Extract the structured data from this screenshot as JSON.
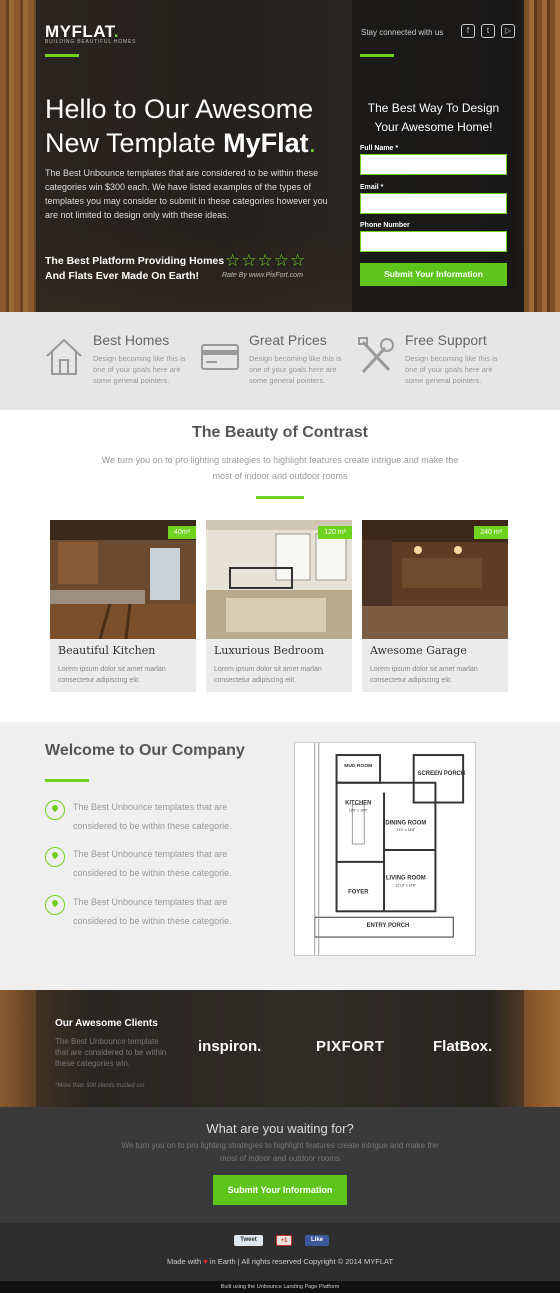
{
  "hero": {
    "logo": "MYFLAT",
    "logo_dot": ".",
    "logo_sub": "BUILDING BEAUTIFUL HOMES",
    "title_line1": "Hello to Our Awesome",
    "title_line2_pre": "New Template ",
    "title_line2_bold": "MyFlat",
    "title_dot": ".",
    "paragraph": "The Best Unbounce templates that are considered to be within these categories win $300 each. We have listed examples of the types of templates you may consider to submit in these categories however you are not limited to design only with these ideas.",
    "tagline": "The Best Platform Providing Homes And Flats Ever Made On Earth!",
    "stars": "☆☆☆☆☆",
    "rated_by": "Rate By www.PixFort.com",
    "stay_connected": "Stay connected with us",
    "social": [
      {
        "icon": "facebook-icon",
        "glyph": "f"
      },
      {
        "icon": "twitter-icon",
        "glyph": "t"
      },
      {
        "icon": "youtube-icon",
        "glyph": "▷"
      }
    ]
  },
  "form": {
    "title": "The Best Way To Design Your Awesome Home!",
    "full_name_label": "Full Name *",
    "email_label": "Email *",
    "phone_label": "Phone Number",
    "submit": "Submit Your Information"
  },
  "features": [
    {
      "icon": "house-icon",
      "title": "Best Homes",
      "desc": "Design becoming like this is one of your goals here are some general pointers."
    },
    {
      "icon": "credit-card-icon",
      "title": "Great Prices",
      "desc": "Design becoming like this is one of your goals here are some general pointers."
    },
    {
      "icon": "tools-icon",
      "title": "Free Support",
      "desc": "Design becoming like this is one of your goals here are some general pointers."
    }
  ],
  "beauty": {
    "title": "The Beauty of Contrast",
    "subtitle": "We turn you on to pro lighting strategies to highlight features create intrigue and make the most of indoor and outdoor rooms",
    "cards": [
      {
        "title": "Beautiful Kitchen",
        "badge": "40m²",
        "desc": "Lorem ipsum dolor sit amet marlan consectetur adipiscing elit."
      },
      {
        "title": "Luxurious Bedroom",
        "badge": "120 m²",
        "desc": "Lorem ipsum dolor sit amet marlan consectetur adipiscing elit."
      },
      {
        "title": "Awesome Garage",
        "badge": "240 m²",
        "desc": "Lorem ipsum dolor sit amet marlan consectetur adipiscing elit."
      }
    ]
  },
  "welcome": {
    "title": "Welcome to Our Company",
    "items": [
      "The Best Unbounce templates that are considered to be within these categorie.",
      "The Best Unbounce templates that are considered to be within these categorie.",
      "The Best Unbounce templates that are considered to be within these categorie."
    ],
    "plan_labels": {
      "mud_room": "MUD ROOM",
      "screen_porch": "SCREEN PORCH",
      "kitchen": "KITCHEN",
      "kitchen_dim": "10'6\" x 14'0\"",
      "dining": "DINING ROOM",
      "dining_dim": "13'0\" x 14'8\"",
      "living": "LIVING ROOM",
      "living_dim": "12'10\" x 14'8\"",
      "foyer": "FOYER",
      "entry": "ENTRY PORCH"
    }
  },
  "clients": {
    "title": "Our Awesome Clients",
    "text": "The Best Unbounce template that are considered to be within these categories win.",
    "note": "*More than 500 clients trusted us!",
    "brands": [
      "inspiron.",
      "PIXFORT",
      "FlatBox."
    ]
  },
  "cta": {
    "title": "What are you waiting for?",
    "subtitle": "We turn you on to pro lighting strategies to highlight features create intrigue and make the most of indoor and outdoor rooms",
    "button": "Submit Your Information"
  },
  "footer": {
    "tweet": "Tweet",
    "gplus": "+1",
    "like": "Like",
    "made_with": "Made with",
    "heart": "♥",
    "copyright": "in Earth | All rights reserved Copyright © 2014 MYFLAT",
    "built": "Built using the Unbounce Landing Page Platform"
  },
  "colors": {
    "accent": "#6fd21f",
    "dark": "#3a3a3a",
    "light_gray": "#e6e6e6"
  }
}
